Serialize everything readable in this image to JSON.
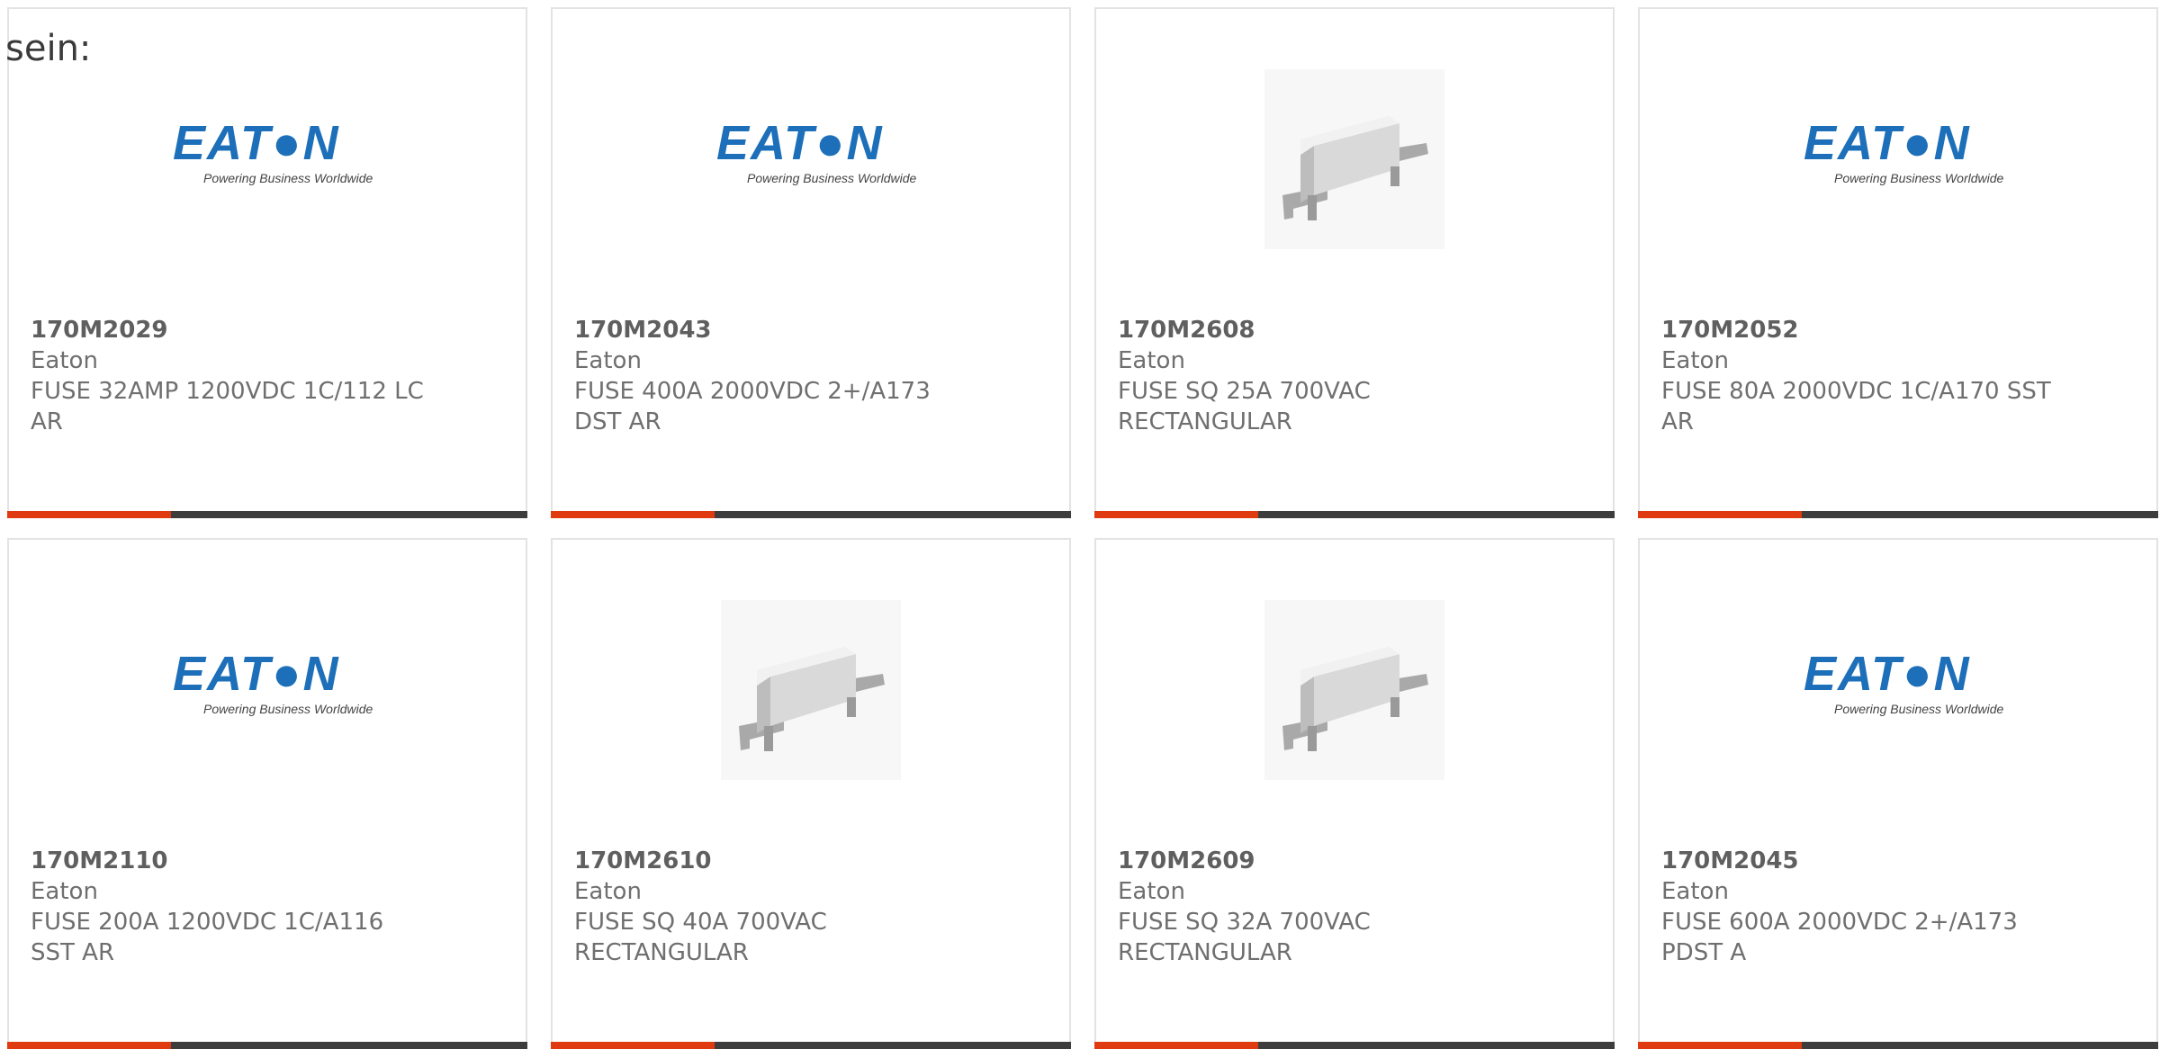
{
  "intro_text": "sein:",
  "logo": {
    "word": "EAT●N",
    "tagline": "Powering Business Worldwide"
  },
  "colors": {
    "accent": "#e03a10",
    "bar": "#3d3d3d",
    "eaton_blue": "#1c6fb8"
  },
  "products": [
    {
      "part_number": "170M2029",
      "brand": "Eaton",
      "description": "FUSE 32AMP 1200VDC 1C/112 LC AR",
      "image": "eaton-logo"
    },
    {
      "part_number": "170M2043",
      "brand": "Eaton",
      "description": "FUSE 400A 2000VDC 2+/A173 DST AR",
      "image": "eaton-logo"
    },
    {
      "part_number": "170M2608",
      "brand": "Eaton",
      "description": "FUSE SQ 25A 700VAC RECTANGULAR",
      "image": "fuse-photo"
    },
    {
      "part_number": "170M2052",
      "brand": "Eaton",
      "description": "FUSE 80A 2000VDC 1C/A170 SST AR",
      "image": "eaton-logo"
    },
    {
      "part_number": "170M2110",
      "brand": "Eaton",
      "description": "FUSE 200A 1200VDC 1C/A116 SST AR",
      "image": "eaton-logo"
    },
    {
      "part_number": "170M2610",
      "brand": "Eaton",
      "description": "FUSE SQ 40A 700VAC RECTANGULAR",
      "image": "fuse-photo"
    },
    {
      "part_number": "170M2609",
      "brand": "Eaton",
      "description": "FUSE SQ 32A 700VAC RECTANGULAR",
      "image": "fuse-photo"
    },
    {
      "part_number": "170M2045",
      "brand": "Eaton",
      "description": "FUSE 600A 2000VDC 2+/A173 PDST A",
      "image": "eaton-logo"
    }
  ]
}
